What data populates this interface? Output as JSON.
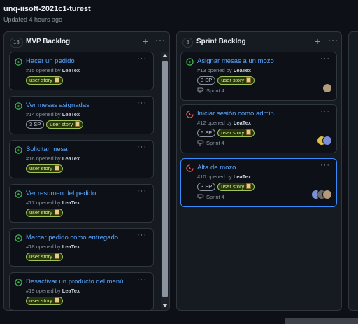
{
  "project": {
    "title": "unq-iisoft-2021c1-turest",
    "updated": "Updated 4 hours ago"
  },
  "columns": [
    {
      "name": "MVP Backlog",
      "count": "13",
      "cards": [
        {
          "title": "Hacer un pedido",
          "number": "#15",
          "opened_by_text": "opened by",
          "author": "LeaTex",
          "status": "open",
          "labels": [
            "user story"
          ]
        },
        {
          "title": "Ver mesas asignadas",
          "number": "#14",
          "opened_by_text": "opened by",
          "author": "LeaTex",
          "status": "open",
          "labels": [
            "3 SP",
            "user story"
          ]
        },
        {
          "title": "Solicitar mesa",
          "number": "#16",
          "opened_by_text": "opened by",
          "author": "LeaTex",
          "status": "open",
          "labels": [
            "user story"
          ]
        },
        {
          "title": "Ver resumen del pedido",
          "number": "#17",
          "opened_by_text": "opened by",
          "author": "LeaTex",
          "status": "open",
          "labels": [
            "user story"
          ]
        },
        {
          "title": "Marcar pedido como entregado",
          "number": "#18",
          "opened_by_text": "opened by",
          "author": "LeaTex",
          "status": "open",
          "labels": [
            "user story"
          ]
        },
        {
          "title": "Desactivar un producto del menú",
          "number": "#19",
          "opened_by_text": "opened by",
          "author": "LeaTex",
          "status": "open",
          "labels": [
            "user story"
          ]
        }
      ]
    },
    {
      "name": "Sprint Backlog",
      "count": "3",
      "cards": [
        {
          "title": "Asignar mesas a un mozo",
          "number": "#13",
          "opened_by_text": "opened by",
          "author": "LeaTex",
          "status": "open",
          "labels": [
            "3 SP",
            "user story"
          ],
          "milestone": "Sprint 4",
          "avatars": 1
        },
        {
          "title": "Iniciar sesión como admin",
          "number": "#12",
          "opened_by_text": "opened by",
          "author": "LeaTex",
          "status": "in-progress",
          "labels": [
            "5 SP",
            "user story"
          ],
          "milestone": "Sprint 4",
          "avatars": 2
        },
        {
          "title": "Alta de mozo",
          "number": "#10",
          "opened_by_text": "opened by",
          "author": "LeaTex",
          "status": "in-progress",
          "labels": [
            "3 SP",
            "user story"
          ],
          "milestone": "Sprint 4",
          "avatars": 3,
          "selected": true
        }
      ]
    }
  ],
  "colors": {
    "background": "#0d1117",
    "column": "#161b22",
    "border": "#30363d",
    "link": "#58a6ff",
    "status_open": "#3fb950",
    "status_in_progress": "#f85149",
    "selected_border": "#388bfd",
    "user_story_label": "#a0c45a"
  },
  "icons": {
    "add": "plus-icon",
    "more": "kebab-icon",
    "open": "issue-opened-icon",
    "in_progress": "issue-in-progress-icon",
    "milestone": "milestone-icon",
    "label_emoji": "memo-icon"
  }
}
